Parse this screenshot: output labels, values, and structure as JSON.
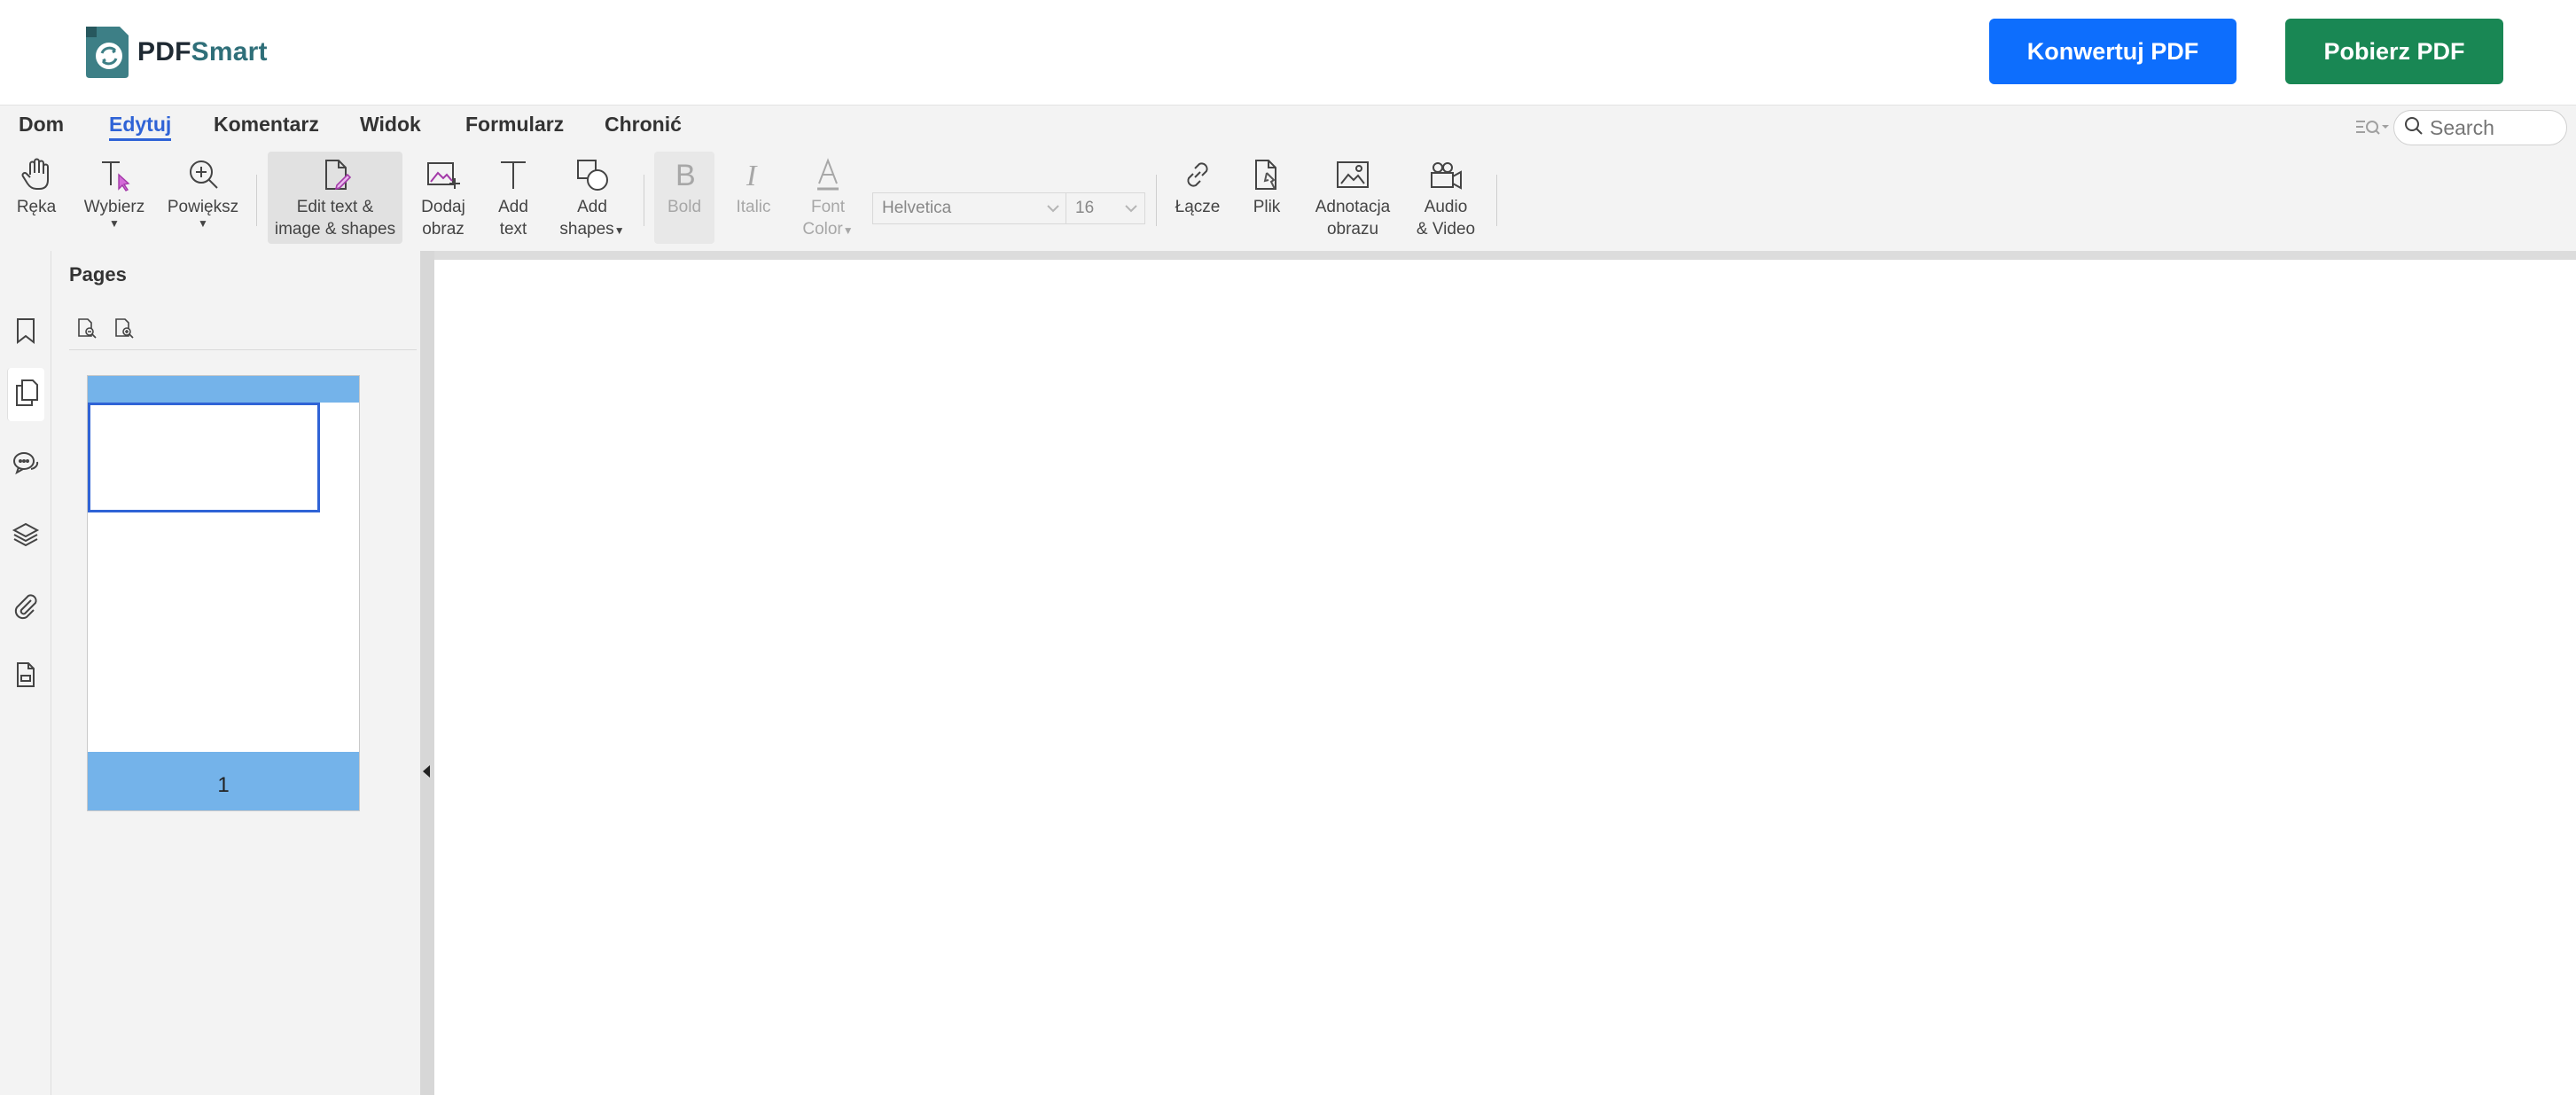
{
  "brand": {
    "name_part1": "PDF",
    "name_part2": "Smart"
  },
  "header": {
    "convert_label": "Konwertuj PDF",
    "download_label": "Pobierz PDF"
  },
  "menu": {
    "items": [
      "Dom",
      "Edytuj",
      "Komentarz",
      "Widok",
      "Formularz",
      "Chronić"
    ],
    "active": "Edytuj"
  },
  "search": {
    "placeholder": "Search"
  },
  "toolbar": {
    "hand": "Ręka",
    "select": "Wybierz",
    "zoom": "Powiększ",
    "edit_text_line1": "Edit text &",
    "edit_text_line2": "image & shapes",
    "add_image_line1": "Dodaj",
    "add_image_line2": "obraz",
    "add_text_line1": "Add",
    "add_text_line2": "text",
    "add_shapes_line1": "Add",
    "add_shapes_line2": "shapes",
    "bold": "Bold",
    "italic": "Italic",
    "font_color_line1": "Font",
    "font_color_line2": "Color",
    "font_family": "Helvetica",
    "font_size": "16",
    "link": "Łącze",
    "file": "Plik",
    "image_annot_line1": "Adnotacja",
    "image_annot_line2": "obrazu",
    "av_line1": "Audio",
    "av_line2": "& Video"
  },
  "pages_panel": {
    "title": "Pages",
    "page_number": "1"
  },
  "colors": {
    "accent": "#2f63d6",
    "convert": "#0d6efd",
    "download": "#198754",
    "thumb_band": "#74b3ea"
  }
}
